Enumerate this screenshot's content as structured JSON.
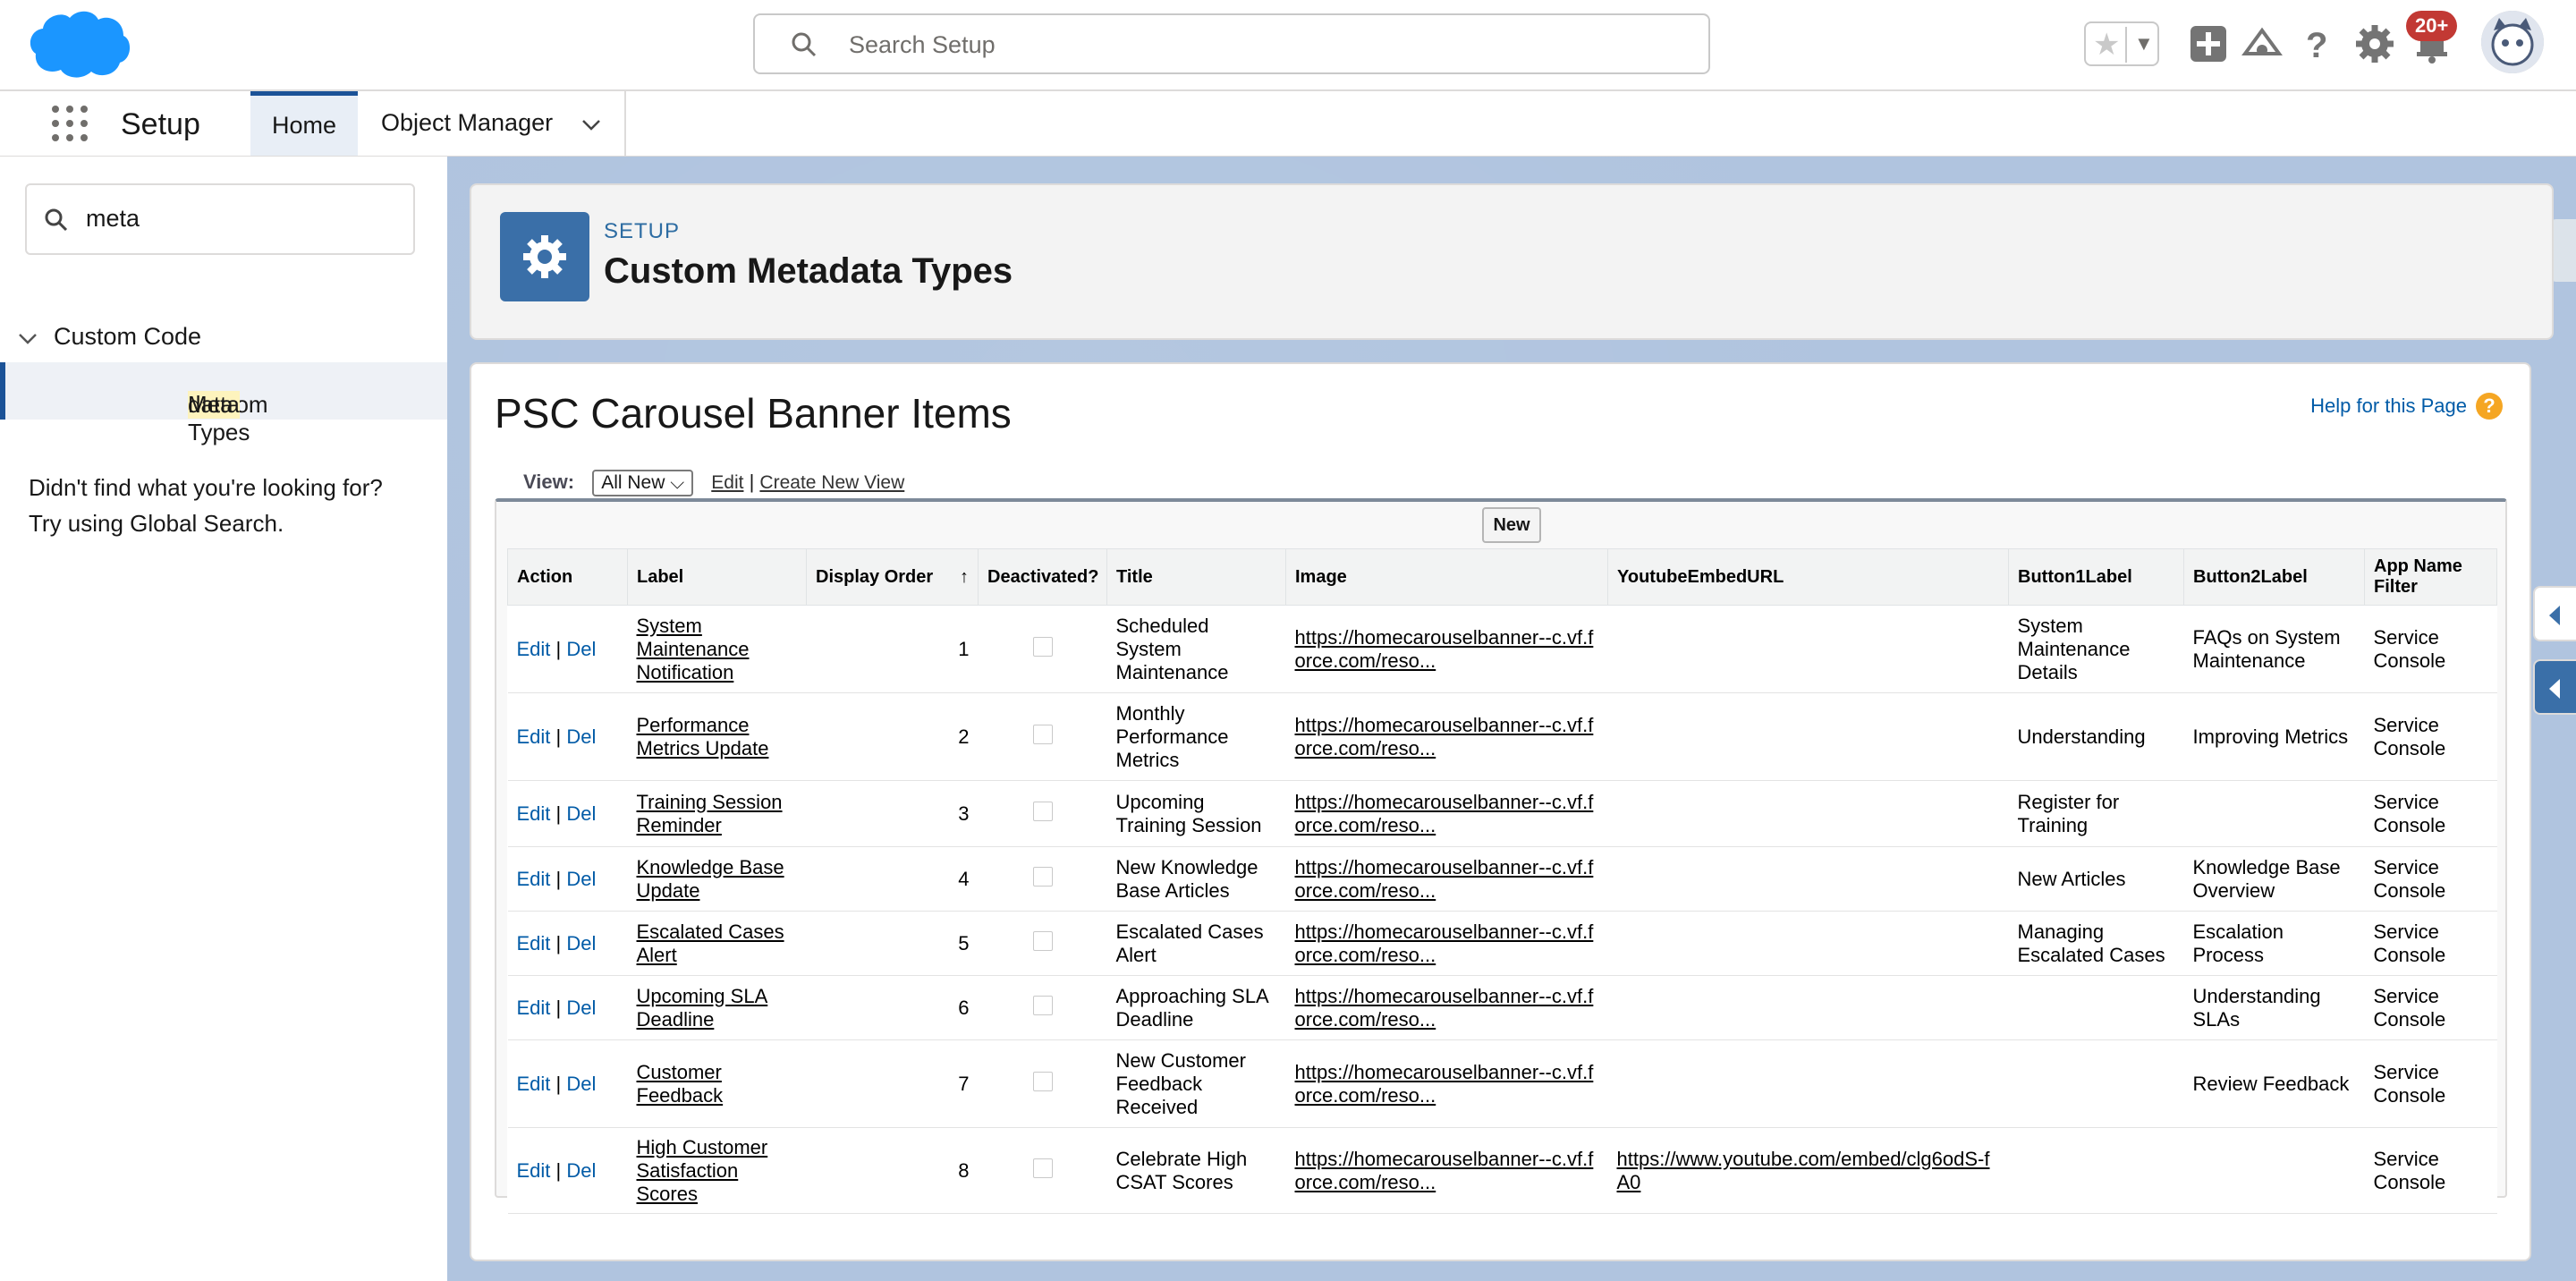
{
  "header": {
    "search_placeholder": "Search Setup",
    "notification_badge": "20+",
    "brand_color": "#00a1e0"
  },
  "nav": {
    "app_name": "Setup",
    "tabs": [
      {
        "label": "Home"
      },
      {
        "label": "Object Manager"
      }
    ]
  },
  "sidebar": {
    "quick_find_value": "meta",
    "section_label": "Custom Code",
    "item_prefix": "Custom ",
    "item_highlight": "Meta",
    "item_suffix": "data Types",
    "not_found_line1": "Didn't find what you're looking for?",
    "not_found_line2": "Try using Global Search."
  },
  "page_header": {
    "subtitle": "SETUP",
    "title": "Custom Metadata Types"
  },
  "list": {
    "title": "PSC Carousel Banner Items",
    "help_link": "Help for this Page",
    "view_label": "View:",
    "view_selected": "All New",
    "edit_link": "Edit",
    "separator": "|",
    "create_view_link": "Create New View",
    "new_button": "New",
    "columns": [
      "Action",
      "Label",
      "Display Order",
      "Deactivated?",
      "Title",
      "Image",
      "YoutubeEmbedURL",
      "Button1Label",
      "Button2Label",
      "App Name Filter"
    ],
    "sort_indicator": "↑",
    "rows": [
      {
        "edit": "Edit",
        "del": "Del",
        "label": "System Maintenance Notification",
        "order": "1",
        "title": "Scheduled System Maintenance",
        "image": "https://homecarouselbanner--c.vf.force.com/reso...",
        "youtube": "",
        "button1": "System Maintenance Details",
        "button2": "FAQs on System Maintenance",
        "app": "Service Console"
      },
      {
        "edit": "Edit",
        "del": "Del",
        "label": "Performance Metrics Update",
        "order": "2",
        "title": "Monthly Performance Metrics",
        "image": "https://homecarouselbanner--c.vf.force.com/reso...",
        "youtube": "",
        "button1": "Understanding",
        "button2": "Improving Metrics",
        "app": "Service Console"
      },
      {
        "edit": "Edit",
        "del": "Del",
        "label": "Training Session Reminder",
        "order": "3",
        "title": "Upcoming Training Session",
        "image": "https://homecarouselbanner--c.vf.force.com/reso...",
        "youtube": "",
        "button1": "Register for Training",
        "button2": "",
        "app": "Service Console"
      },
      {
        "edit": "Edit",
        "del": "Del",
        "label": "Knowledge Base Update",
        "order": "4",
        "title": "New Knowledge Base Articles",
        "image": "https://homecarouselbanner--c.vf.force.com/reso...",
        "youtube": "",
        "button1": "New Articles",
        "button2": "Knowledge Base Overview",
        "app": "Service Console"
      },
      {
        "edit": "Edit",
        "del": "Del",
        "label": "Escalated Cases Alert",
        "order": "5",
        "title": "Escalated Cases Alert",
        "image": "https://homecarouselbanner--c.vf.force.com/reso...",
        "youtube": "",
        "button1": "Managing Escalated Cases",
        "button2": "Escalation Process",
        "app": "Service Console"
      },
      {
        "edit": "Edit",
        "del": "Del",
        "label": "Upcoming SLA Deadline",
        "order": "6",
        "title": "Approaching SLA Deadline",
        "image": "https://homecarouselbanner--c.vf.force.com/reso...",
        "youtube": "",
        "button1": "",
        "button2": "Understanding SLAs",
        "app": "Service Console"
      },
      {
        "edit": "Edit",
        "del": "Del",
        "label": "Customer Feedback",
        "order": "7",
        "title": "New Customer Feedback Received",
        "image": "https://homecarouselbanner--c.vf.force.com/reso...",
        "youtube": "",
        "button1": "",
        "button2": "Review Feedback",
        "app": "Service Console"
      },
      {
        "edit": "Edit",
        "del": "Del",
        "label": "High Customer Satisfaction Scores",
        "order": "8",
        "title": "Celebrate High CSAT Scores",
        "image": "https://homecarouselbanner--c.vf.force.com/reso...",
        "youtube": "https://www.youtube.com/embed/clg6odS-fA0",
        "button1": "",
        "button2": "",
        "app": "Service Console"
      }
    ]
  }
}
